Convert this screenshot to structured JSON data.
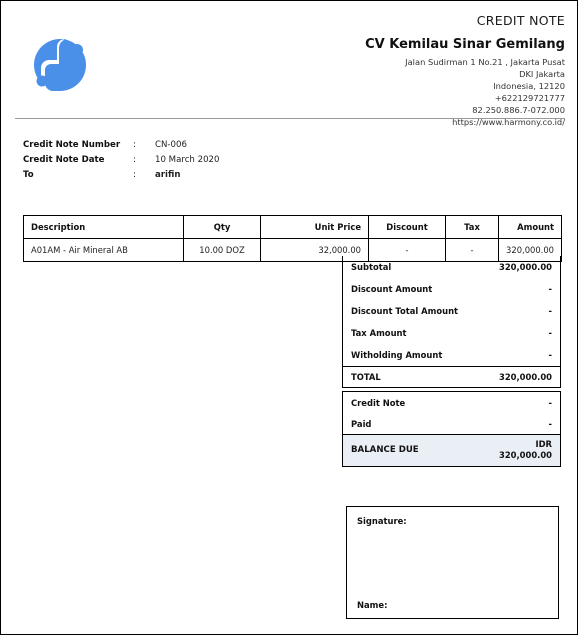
{
  "document": {
    "type_label": "CREDIT NOTE"
  },
  "company": {
    "name": "CV Kemilau Sinar Gemilang",
    "address_line1": "Jalan Sudirman 1 No.21 , Jakarta Pusat",
    "address_line2": "DKI Jakarta",
    "address_line3": "Indonesia, 12120",
    "phone": "+622129721777",
    "tax_id": "82.250.886.7-072.000",
    "website": "https://www.harmony.co.id/"
  },
  "logo": {
    "icon": "harmony-logo-icon",
    "color": "#4a90e8"
  },
  "meta": {
    "rows": [
      {
        "label": "Credit Note Number",
        "separator": ":",
        "value": "CN-006",
        "bold": false
      },
      {
        "label": "Credit Note Date",
        "separator": ":",
        "value": "10 March 2020",
        "bold": false
      },
      {
        "label": "To",
        "separator": ":",
        "value": "arifin",
        "bold": true
      }
    ]
  },
  "items_table": {
    "columns": [
      "Description",
      "Qty",
      "Unit Price",
      "Discount",
      "Tax",
      "Amount"
    ],
    "rows": [
      {
        "description": "A01AM - Air Mineral AB",
        "qty": "10.00 DOZ",
        "unit_price": "32,000.00",
        "discount": "-",
        "tax": "-",
        "amount": "320,000.00"
      }
    ]
  },
  "totals": {
    "rows": [
      {
        "label": "Subtotal",
        "value": "320,000.00"
      },
      {
        "label": "Discount Amount",
        "value": "-"
      },
      {
        "label": "Discount Total Amount",
        "value": "-"
      },
      {
        "label": "Tax Amount",
        "value": "-"
      },
      {
        "label": "Witholding Amount",
        "value": "-"
      }
    ],
    "total": {
      "label": "TOTAL",
      "value": "320,000.00"
    }
  },
  "balance": {
    "rows": [
      {
        "label": "Credit Note",
        "value": "-"
      },
      {
        "label": "Paid",
        "value": "-"
      }
    ],
    "due": {
      "label": "BALANCE DUE",
      "currency": "IDR",
      "amount": "320,000.00",
      "background_color": "#eaeff6"
    }
  },
  "signature": {
    "signature_label": "Signature:",
    "name_label": "Name:"
  }
}
